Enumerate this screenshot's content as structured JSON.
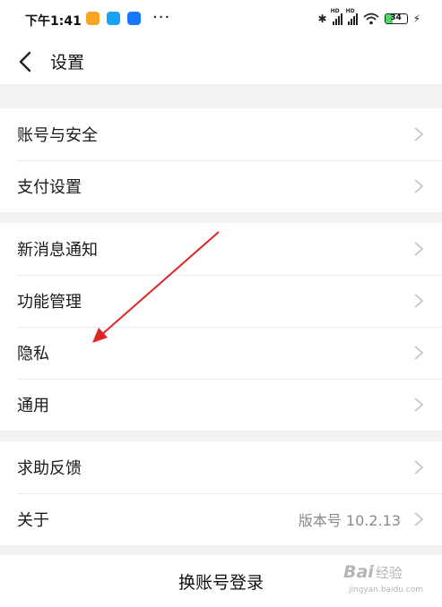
{
  "status_bar": {
    "time": "下午1:41",
    "more": "···",
    "signal_label": "HD",
    "battery_level": "34",
    "battery_fraction": 0.34
  },
  "nav": {
    "title": "设置",
    "back_icon": "chevron-left-icon"
  },
  "groups": [
    {
      "items": [
        {
          "label": "账号与安全"
        },
        {
          "label": "支付设置"
        }
      ]
    },
    {
      "items": [
        {
          "label": "新消息通知"
        },
        {
          "label": "功能管理"
        },
        {
          "label": "隐私"
        },
        {
          "label": "通用"
        }
      ]
    },
    {
      "items": [
        {
          "label": "求助反馈"
        },
        {
          "label": "关于",
          "value": "版本号 10.2.13"
        }
      ]
    }
  ],
  "switch_account": {
    "label": "换账号登录"
  },
  "watermark": {
    "brand": "Bai",
    "brand2": "经验",
    "url": "jingyan.baidu.com"
  },
  "colors": {
    "annotation_arrow": "#e02424",
    "page_background": "#f2f2f2",
    "battery_fill": "#4cd964"
  }
}
